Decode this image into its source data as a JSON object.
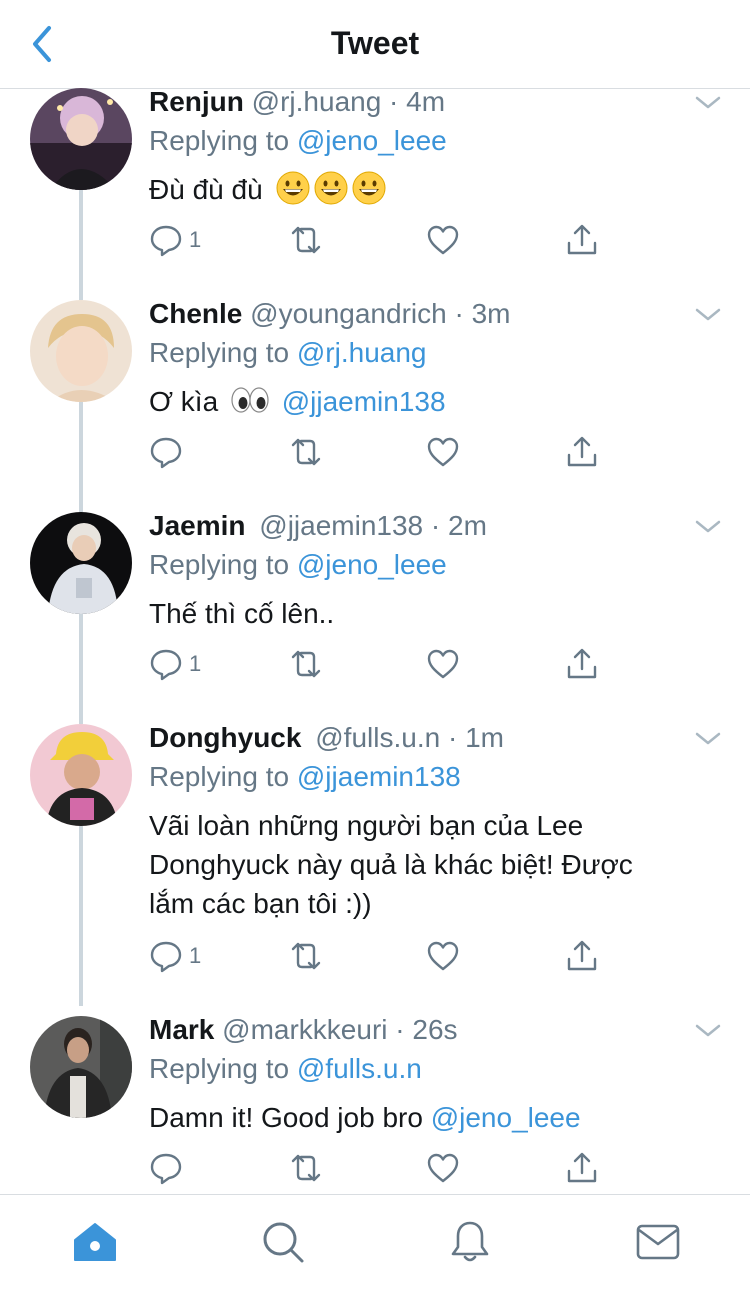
{
  "header": {
    "title": "Tweet",
    "back_icon": "chevron-left-icon",
    "accent": "#3b94d9"
  },
  "colors": {
    "link": "#3b94d9",
    "muted": "#657786",
    "text": "#14171a",
    "divider": "#d9dde1",
    "home_active": "#3b94d9"
  },
  "tweets": [
    {
      "name": "Renjun",
      "handle": "@rj.huang",
      "time": "4m",
      "reply_prefix": "Replying to",
      "reply_to": "@jeno_leee",
      "text": "Đù đù đù",
      "emoji": [
        "grinning-face",
        "grinning-face",
        "grinning-face"
      ],
      "reply_count": "1"
    },
    {
      "name": "Chenle",
      "handle": "@youngandrich",
      "time": "3m",
      "reply_prefix": "Replying to",
      "reply_to": "@rj.huang",
      "text": "Ơ kìa",
      "emoji": [
        "eyes"
      ],
      "mention": "@jjaemin138",
      "reply_count": ""
    },
    {
      "name": "Jaemin",
      "handle": "@jjaemin138",
      "time": "2m",
      "reply_prefix": "Replying to",
      "reply_to": "@jeno_leee",
      "text": "Thế thì cố lên..",
      "reply_count": "1"
    },
    {
      "name": "Donghyuck",
      "handle": "@fulls.u.n",
      "time": "1m",
      "reply_prefix": "Replying to",
      "reply_to": "@jjaemin138",
      "text_lines": [
        "Vãi loàn những người bạn của Lee",
        "Donghyuck này quả là khác biệt! Được",
        "lắm các bạn tôi :))"
      ],
      "reply_count": "1"
    },
    {
      "name": "Mark",
      "handle": "@markkkeuri",
      "time": "26s",
      "reply_prefix": "Replying to",
      "reply_to": "@fulls.u.n",
      "text": "Damn it! Good job bro",
      "mention": "@jeno_leee",
      "reply_count": ""
    }
  ],
  "tabbar": [
    "home-icon",
    "search-icon",
    "bell-icon",
    "mail-icon"
  ]
}
